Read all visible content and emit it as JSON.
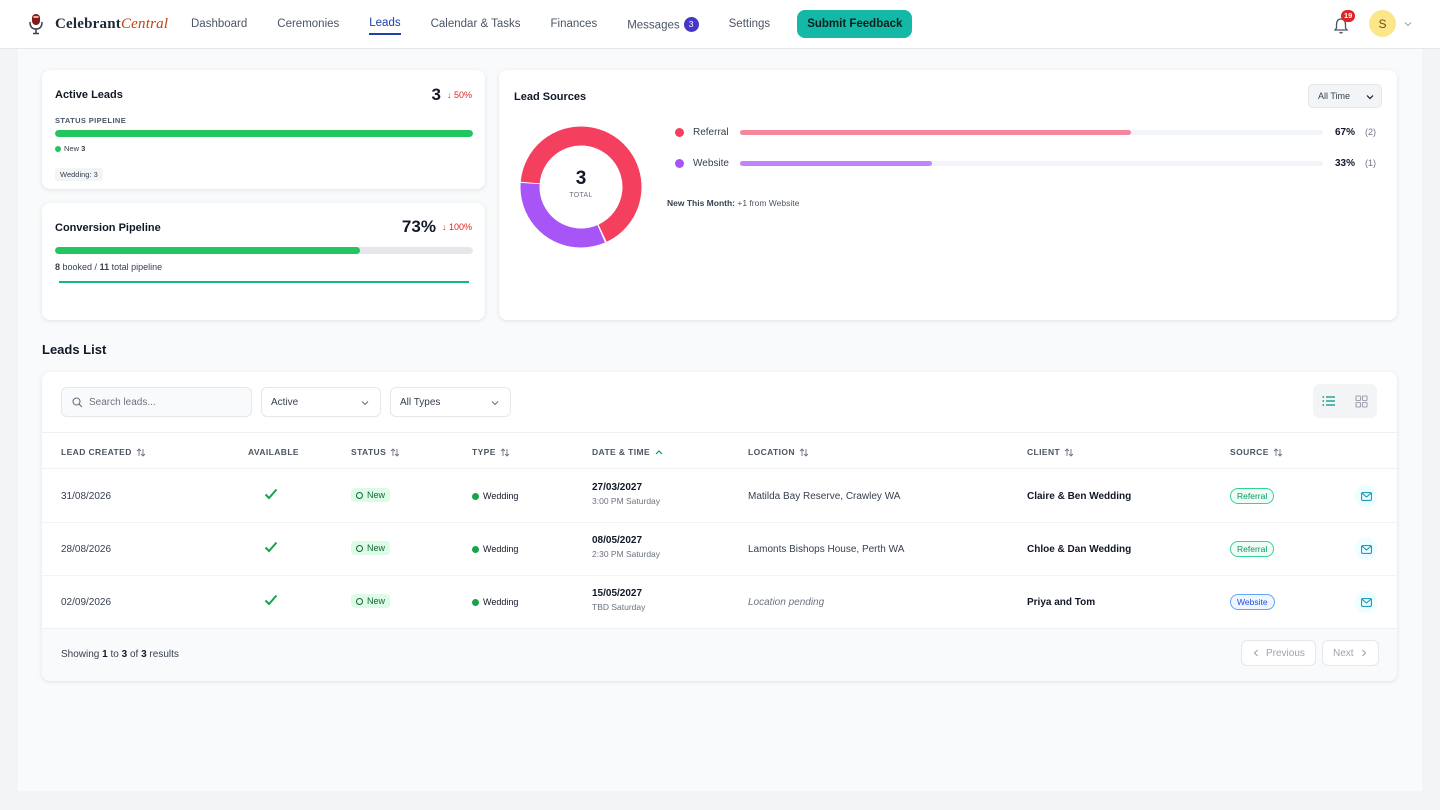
{
  "nav": {
    "logo_main": "Celebrant",
    "logo_accent": "Central",
    "items": [
      {
        "label": "Dashboard"
      },
      {
        "label": "Ceremonies"
      },
      {
        "label": "Leads"
      },
      {
        "label": "Calendar & Tasks"
      },
      {
        "label": "Finances"
      },
      {
        "label": "Messages"
      },
      {
        "label": "Settings"
      }
    ],
    "messages_badge": "3",
    "feedback_label": "Submit Feedback",
    "notifications_count": "19",
    "avatar_initial": "S"
  },
  "active_leads": {
    "title": "Active Leads",
    "count": "3",
    "change": "50%",
    "pipeline_label": "STATUS PIPELINE",
    "legend_label": "New",
    "legend_count": "3",
    "progress_fraction": 1.0,
    "chip": "Wedding: 3"
  },
  "conversion": {
    "title": "Conversion Pipeline",
    "rate": "73%",
    "change": "100%",
    "booked": "8",
    "booked_text": "booked /",
    "total": "11",
    "total_text": "total pipeline",
    "progress_fraction": 0.73
  },
  "lead_sources": {
    "title": "Lead Sources",
    "filter": "All Time",
    "total": "3",
    "total_label": "TOTAL",
    "new_this_month_label": "New This Month:",
    "new_this_month_value": "+1 from Website",
    "sources": [
      {
        "name": "Referral",
        "percent": "67%",
        "count": "(2)",
        "fraction": 0.67,
        "color": "#f43f5e",
        "bar_color": "#f4879c"
      },
      {
        "name": "Website",
        "percent": "33%",
        "count": "(1)",
        "fraction": 0.33,
        "color": "#a855f7",
        "bar_color": "#c084fc"
      }
    ]
  },
  "leads_list": {
    "title": "Leads List",
    "search_placeholder": "Search leads...",
    "status_filter": "Active",
    "type_filter": "All Types",
    "columns": [
      "LEAD CREATED",
      "AVAILABLE",
      "STATUS",
      "TYPE",
      "DATE & TIME",
      "LOCATION",
      "CLIENT",
      "SOURCE"
    ],
    "rows": [
      {
        "created": "31/08/2026",
        "status": "New",
        "type": "Wedding",
        "date": "27/03/2027",
        "time": "3:00 PM Saturday",
        "location": "Matilda Bay Reserve, Crawley WA",
        "location_pending": false,
        "client": "Claire & Ben Wedding",
        "source": "Referral"
      },
      {
        "created": "28/08/2026",
        "status": "New",
        "type": "Wedding",
        "date": "08/05/2027",
        "time": "2:30 PM Saturday",
        "location": "Lamonts Bishops House, Perth WA",
        "location_pending": false,
        "client": "Chloe & Dan Wedding",
        "source": "Referral"
      },
      {
        "created": "02/09/2026",
        "status": "New",
        "type": "Wedding",
        "date": "15/05/2027",
        "time": "TBD Saturday",
        "location": "Location pending",
        "location_pending": true,
        "client": "Priya and Tom",
        "source": "Website"
      }
    ],
    "footer": {
      "showing": "Showing",
      "from": "1",
      "to_text": "to",
      "to": "3",
      "of_text": "of",
      "total": "3",
      "results_text": "results"
    },
    "previous_label": "Previous",
    "next_label": "Next"
  }
}
